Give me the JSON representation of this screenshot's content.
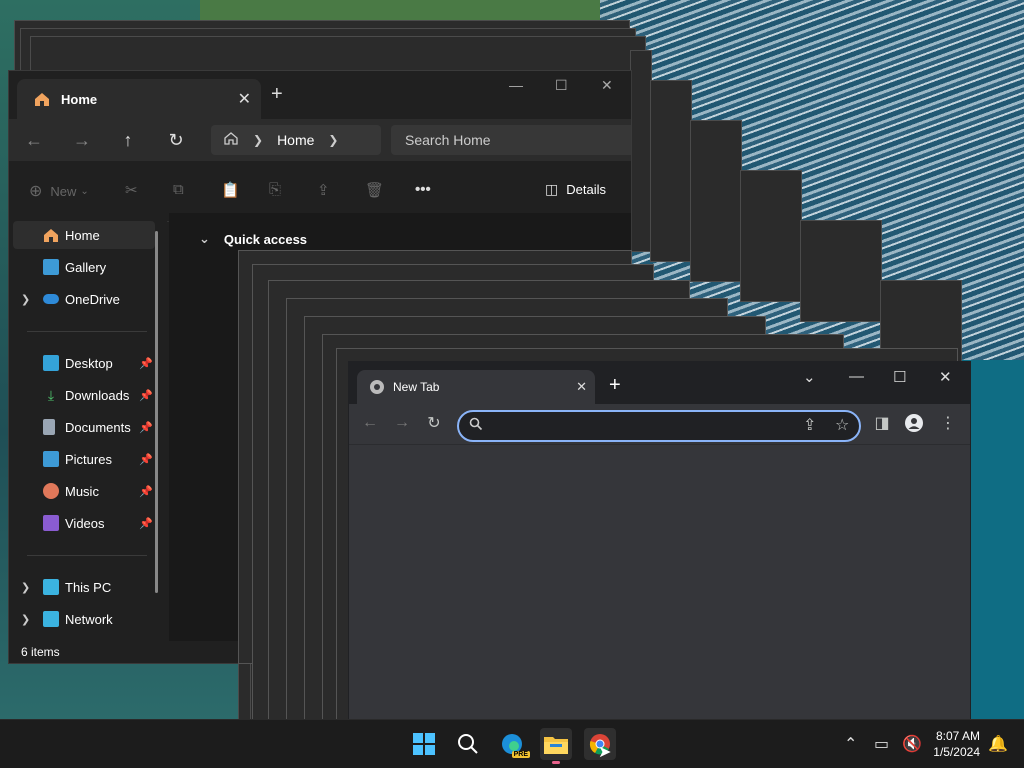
{
  "explorer": {
    "tab_title": "Home",
    "address_label": "Home",
    "search_placeholder": "Search Home",
    "new_label": "New",
    "details_label": "Details",
    "quick_access_label": "Quick access",
    "sidebar": {
      "home": "Home",
      "gallery": "Gallery",
      "onedrive": "OneDrive",
      "desktop": "Desktop",
      "downloads": "Downloads",
      "documents": "Documents",
      "pictures": "Pictures",
      "music": "Music",
      "videos": "Videos",
      "this_pc": "This PC",
      "network": "Network"
    },
    "status_text": "6 items"
  },
  "chrome": {
    "tab_title": "New Tab",
    "omnibox_value": ""
  },
  "taskbar": {
    "time": "8:07 AM",
    "date": "1/5/2024",
    "edge_badge": "PRE"
  },
  "colors": {
    "chrome_focus": "#8ab4f8",
    "explorer_bg": "#202020",
    "chrome_bg": "#35363a"
  }
}
